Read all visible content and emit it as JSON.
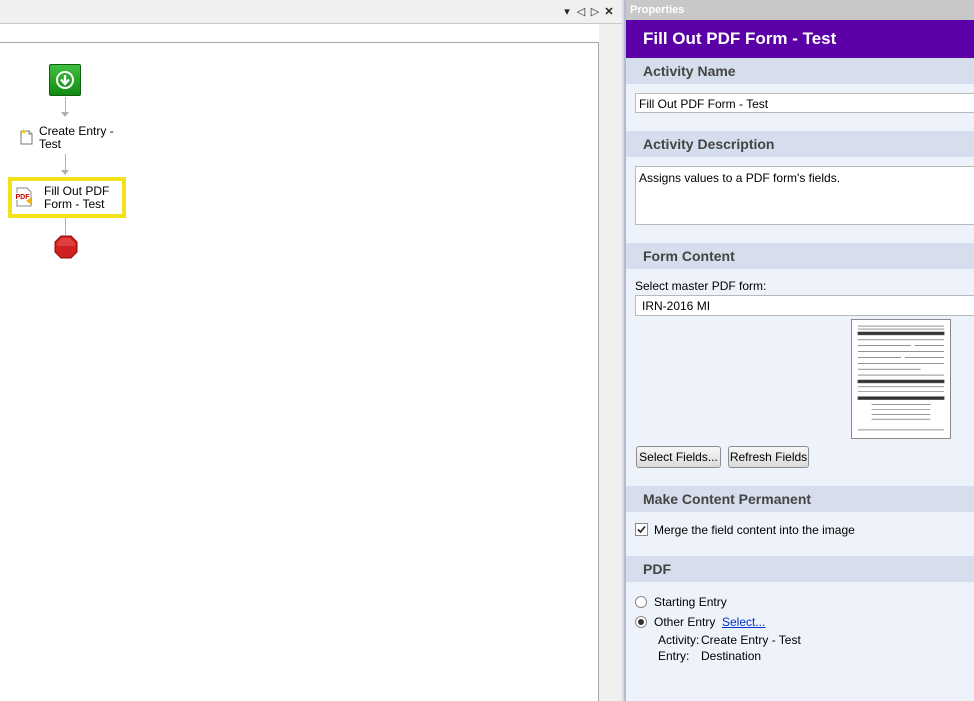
{
  "workflow": {
    "nodes": [
      {
        "label": "Create Entry - Test"
      },
      {
        "label": "Fill Out PDF Form - Test"
      }
    ],
    "pdf_icon_text": "PDF"
  },
  "toolbar": {
    "dropdown_glyph": "▾",
    "prev_glyph": "◁",
    "next_glyph": "▷",
    "close_glyph": "✕"
  },
  "properties": {
    "header": "Properties",
    "title": "Fill Out PDF Form - Test",
    "sections": {
      "activity_name": {
        "heading": "Activity Name",
        "value": "Fill Out PDF Form - Test"
      },
      "activity_description": {
        "heading": "Activity Description",
        "value": "Assigns values to a PDF form's fields."
      },
      "form_content": {
        "heading": "Form Content",
        "select_label": "Select master PDF form:",
        "selected_form": "IRN-2016 MI",
        "select_fields_button": "Select Fields...",
        "refresh_fields_button": "Refresh Fields"
      },
      "make_permanent": {
        "heading": "Make Content Permanent",
        "merge_label": "Merge the field content into the image",
        "merge_checked": true
      },
      "pdf": {
        "heading": "PDF",
        "starting_entry_label": "Starting Entry",
        "other_entry_label": "Other Entry",
        "select_link": "Select...",
        "selected_option": "other",
        "activity_key": "Activity:",
        "activity_value": "Create Entry - Test",
        "entry_key": "Entry:",
        "entry_value": "Destination"
      }
    }
  },
  "colors": {
    "title_bar": "#5b00a6",
    "start_node": "#1fa01f",
    "stop_node": "#d21f1f",
    "selection_highlight": "#f3e21b"
  }
}
